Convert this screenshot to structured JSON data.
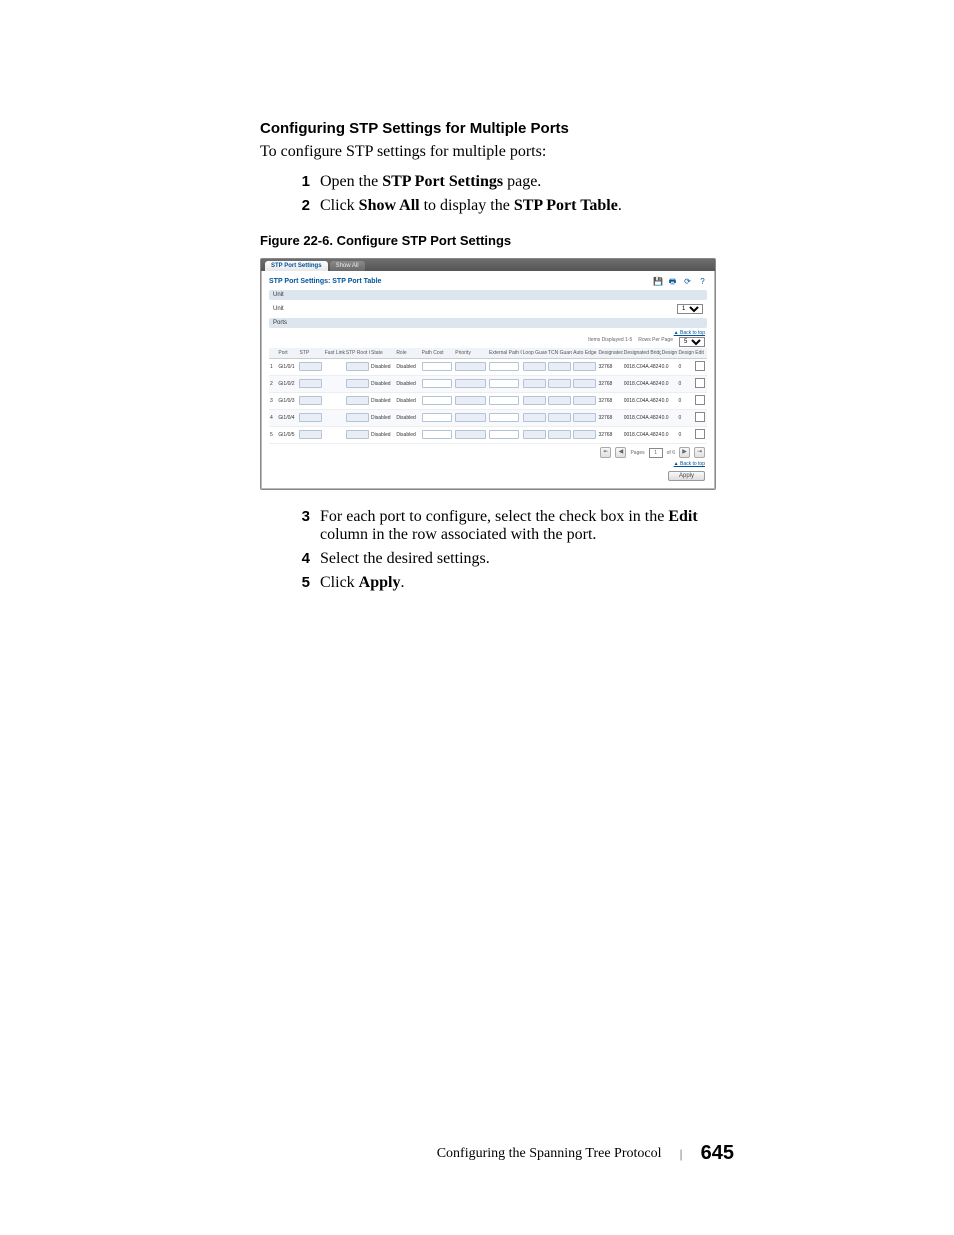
{
  "heading": "Configuring STP Settings for Multiple Ports",
  "intro": "To configure STP settings for multiple ports:",
  "step1_num": "1",
  "step1_pre": "Open the ",
  "step1_b": "STP Port Settings",
  "step1_post": " page.",
  "step2_num": "2",
  "step2_pre": "Click ",
  "step2_b1": "Show All",
  "step2_mid": " to display the ",
  "step2_b2": "STP Port Table",
  "step2_post": ".",
  "fig_caption": "Figure 22-6.    Configure STP Port Settings",
  "shot": {
    "tab_active": "STP Port Settings",
    "tab_inactive": "Show All",
    "title": "STP Port Settings: STP Port Table",
    "sec_unit": "Unit",
    "unit_label": "Unit",
    "unit_value": "1",
    "sec_ports": "Ports",
    "items_disp": "Items Displayed 1-5",
    "rows_label": "Rows Per Page",
    "rows_value": "5",
    "backtop": "▲ Back to top",
    "columns": [
      "",
      "Port",
      "STP",
      "Fast Link",
      "STP Root Guard",
      "State",
      "Role",
      "Path Cost",
      "Priority",
      "External Path Cost",
      "Loop Guard",
      "TCN Guard",
      "Auto Edge",
      "Designated Bridge Priority",
      "Designated Bridge Address",
      "Designated Port ID",
      "Designated Cost",
      "Edit"
    ],
    "rows": [
      {
        "n": "1",
        "port": "Gi1/0/1",
        "state": "Disabled",
        "role": "Disabled",
        "dbp": "32768",
        "dba": "0018.C04A.4824",
        "dpid": "0.0",
        "dcost": "0"
      },
      {
        "n": "2",
        "port": "Gi1/0/2",
        "state": "Disabled",
        "role": "Disabled",
        "dbp": "32768",
        "dba": "0018.C04A.4824",
        "dpid": "0.0",
        "dcost": "0"
      },
      {
        "n": "3",
        "port": "Gi1/0/3",
        "state": "Disabled",
        "role": "Disabled",
        "dbp": "32768",
        "dba": "0018.C04A.4824",
        "dpid": "0.0",
        "dcost": "0"
      },
      {
        "n": "4",
        "port": "Gi1/0/4",
        "state": "Disabled",
        "role": "Disabled",
        "dbp": "32768",
        "dba": "0018.C04A.4824",
        "dpid": "0.0",
        "dcost": "0"
      },
      {
        "n": "5",
        "port": "Gi1/0/5",
        "state": "Disabled",
        "role": "Disabled",
        "dbp": "32768",
        "dba": "0018.C04A.4824",
        "dpid": "0.0",
        "dcost": "0"
      }
    ],
    "pages_label": "Pages",
    "page_cur": "1",
    "page_of": "of 6",
    "apply": "Apply"
  },
  "step3_num": "3",
  "step3_pre": "For each port to configure, select the check box in the ",
  "step3_b": "Edit",
  "step3_post": " column in the row associated with the port.",
  "step4_num": "4",
  "step4_txt": "Select the desired settings.",
  "step5_num": "5",
  "step5_pre": "Click ",
  "step5_b": "Apply",
  "step5_post": ".",
  "footer_chapter": "Configuring the Spanning Tree Protocol",
  "footer_sep": "|",
  "footer_page": "645"
}
